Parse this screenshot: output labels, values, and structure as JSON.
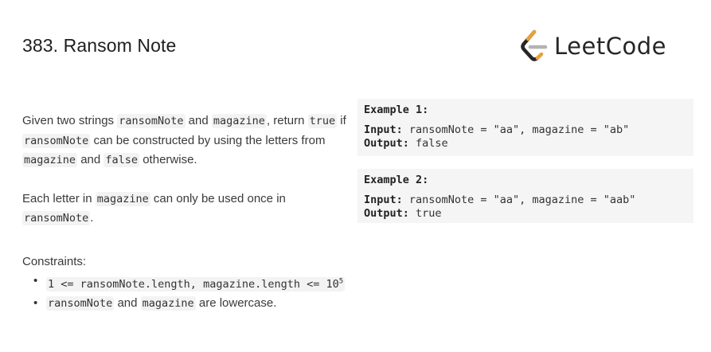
{
  "problem": {
    "title": "383. Ransom Note"
  },
  "brand": {
    "name": "LeetCode",
    "logo_icon": "leetcode-logo-icon",
    "colors": {
      "bracket": "#e7a13b",
      "dark": "#262626",
      "bar": "#b3b3b3"
    }
  },
  "description": {
    "p1": {
      "t1": "Given two strings ",
      "c1": "ransomNote",
      "t2": " and ",
      "c2": "magazine",
      "t3": ", return ",
      "c3": "true",
      "t4": " if ",
      "c4": "ransomNote",
      "t5": " can be constructed by using the letters from ",
      "c5": "magazine",
      "t6": " and ",
      "c6": "false",
      "t7": " otherwise."
    },
    "p2": {
      "t1": "Each letter in ",
      "c1": "magazine",
      "t2": " can only be used once in ",
      "c2": "ransomNote",
      "t3": "."
    }
  },
  "examples": [
    {
      "title": "Example 1:",
      "input_label": "Input:",
      "input": "ransomNote = \"aa\", magazine = \"ab\"",
      "output_label": "Output:",
      "output": "false"
    },
    {
      "title": "Example 2:",
      "input_label": "Input:",
      "input": "ransomNote = \"aa\", magazine = \"aab\"",
      "output_label": "Output:",
      "output": "true"
    }
  ],
  "constraints": {
    "heading": "Constraints:",
    "item1": {
      "code": "1 <= ransomNote.length, magazine.length <= 10",
      "sup": "5"
    },
    "item2": {
      "c1": "ransomNote",
      "t1": " and ",
      "c2": "magazine",
      "t2": " are lowercase."
    }
  }
}
